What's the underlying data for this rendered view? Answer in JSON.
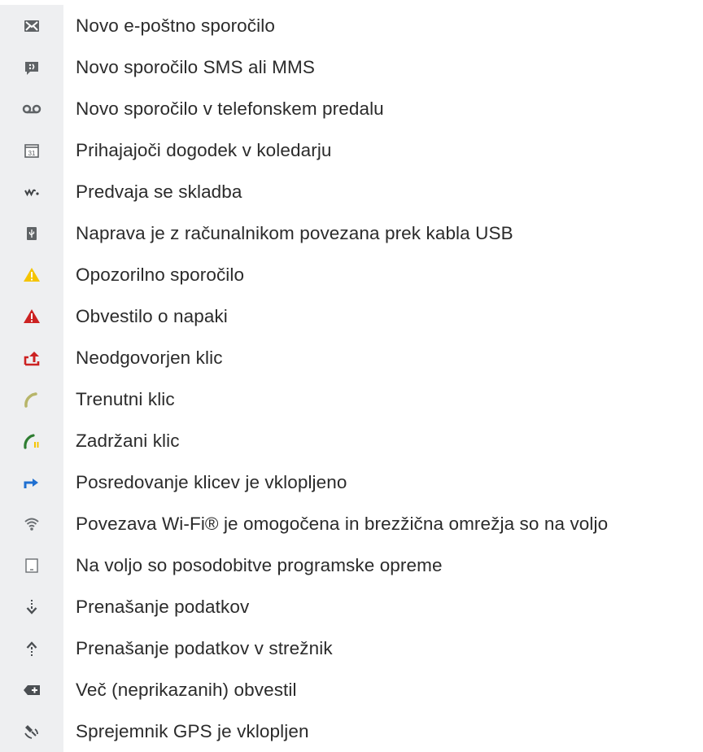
{
  "items": [
    {
      "icon": "envelope-icon",
      "label": "Novo e-poštno sporočilo"
    },
    {
      "icon": "sms-icon",
      "label": "Novo sporočilo SMS ali MMS"
    },
    {
      "icon": "voicemail-icon",
      "label": "Novo sporočilo v telefonskem predalu"
    },
    {
      "icon": "calendar-icon",
      "label": "Prihajajoči dogodek v koledarju"
    },
    {
      "icon": "walkman-icon",
      "label": "Predvaja se skladba"
    },
    {
      "icon": "usb-icon",
      "label": "Naprava je z računalnikom povezana prek kabla USB"
    },
    {
      "icon": "warning-icon",
      "label": "Opozorilno sporočilo"
    },
    {
      "icon": "error-icon",
      "label": "Obvestilo o napaki"
    },
    {
      "icon": "missed-call-icon",
      "label": "Neodgovorjen klic"
    },
    {
      "icon": "call-icon",
      "label": "Trenutni klic"
    },
    {
      "icon": "call-on-hold-icon",
      "label": "Zadržani klic"
    },
    {
      "icon": "call-forward-icon",
      "label": "Posredovanje klicev je vklopljeno"
    },
    {
      "icon": "wifi-icon",
      "label": "Povezava Wi-Fi® je omogočena in brezžična omrežja so na voljo"
    },
    {
      "icon": "software-update-icon",
      "label": "Na voljo so posodobitve programske opreme"
    },
    {
      "icon": "download-icon",
      "label": "Prenašanje podatkov"
    },
    {
      "icon": "upload-icon",
      "label": "Prenašanje podatkov v strežnik"
    },
    {
      "icon": "more-notifications-icon",
      "label": "Več (neprikazanih) obvestil"
    },
    {
      "icon": "gps-icon",
      "label": "Sprejemnik GPS je vklopljen"
    }
  ],
  "colors": {
    "icon_background": "#eeeff1",
    "warning": "#f5c400",
    "error": "#cc2222",
    "call": "#b7b56a",
    "forward": "#1f6fd1"
  }
}
